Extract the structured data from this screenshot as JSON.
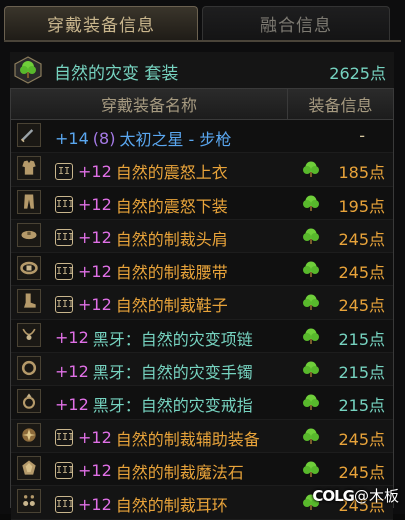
{
  "tabs": {
    "active": "穿戴装备信息",
    "inactive": "融合信息"
  },
  "set": {
    "name": "自然的灾变 套装",
    "points": "2625点",
    "icon": "green-tree-icon"
  },
  "table": {
    "col_name": "穿戴装备名称",
    "col_info": "装备信息"
  },
  "rows": [
    {
      "slot_icon": "sword-icon",
      "badge": "",
      "enhance": "+14",
      "extra": "(8)",
      "name": "太初之星 - 步枪",
      "name_color": "blue",
      "gem": false,
      "points": "-",
      "points_color": "dash"
    },
    {
      "slot_icon": "coat-icon",
      "badge": "II",
      "enhance": "+12",
      "extra": "",
      "name": "自然的震怒上衣",
      "name_color": "gold",
      "gem": true,
      "points": "185点",
      "points_color": "orange"
    },
    {
      "slot_icon": "pants-icon",
      "badge": "III",
      "enhance": "+12",
      "extra": "",
      "name": "自然的震怒下装",
      "name_color": "gold",
      "gem": true,
      "points": "195点",
      "points_color": "orange"
    },
    {
      "slot_icon": "shoulder-icon",
      "badge": "III",
      "enhance": "+12",
      "extra": "",
      "name": "自然的制裁头肩",
      "name_color": "gold",
      "gem": true,
      "points": "245点",
      "points_color": "orange"
    },
    {
      "slot_icon": "belt-icon",
      "badge": "III",
      "enhance": "+12",
      "extra": "",
      "name": "自然的制裁腰带",
      "name_color": "gold",
      "gem": true,
      "points": "245点",
      "points_color": "orange"
    },
    {
      "slot_icon": "boots-icon",
      "badge": "III",
      "enhance": "+12",
      "extra": "",
      "name": "自然的制裁鞋子",
      "name_color": "gold",
      "gem": true,
      "points": "245点",
      "points_color": "orange"
    },
    {
      "slot_icon": "necklace-icon",
      "badge": "",
      "enhance": "+12",
      "extra": "",
      "name": "黑牙：自然的灾变项链",
      "name_color": "teal",
      "gem": true,
      "points": "215点",
      "points_color": "teal"
    },
    {
      "slot_icon": "bracelet-icon",
      "badge": "",
      "enhance": "+12",
      "extra": "",
      "name": "黑牙：自然的灾变手镯",
      "name_color": "teal",
      "gem": true,
      "points": "215点",
      "points_color": "teal"
    },
    {
      "slot_icon": "ring-icon",
      "badge": "",
      "enhance": "+12",
      "extra": "",
      "name": "黑牙：自然的灾变戒指",
      "name_color": "teal",
      "gem": true,
      "points": "215点",
      "points_color": "teal"
    },
    {
      "slot_icon": "support-icon",
      "badge": "III",
      "enhance": "+12",
      "extra": "",
      "name": "自然的制裁辅助装备",
      "name_color": "gold",
      "gem": true,
      "points": "245点",
      "points_color": "orange"
    },
    {
      "slot_icon": "magic-stone-icon",
      "badge": "III",
      "enhance": "+12",
      "extra": "",
      "name": "自然的制裁魔法石",
      "name_color": "gold",
      "gem": true,
      "points": "245点",
      "points_color": "orange"
    },
    {
      "slot_icon": "earring-icon",
      "badge": "III",
      "enhance": "+12",
      "extra": "",
      "name": "自然的制裁耳环",
      "name_color": "gold",
      "gem": true,
      "points": "245点",
      "points_color": "orange"
    }
  ],
  "watermark": {
    "brand": "COLG",
    "text": "@木板"
  },
  "colors": {
    "teal": "#76d3c0",
    "gold": "#e8a33a",
    "magenta": "#e070e6",
    "blue": "#5aa7f0"
  }
}
